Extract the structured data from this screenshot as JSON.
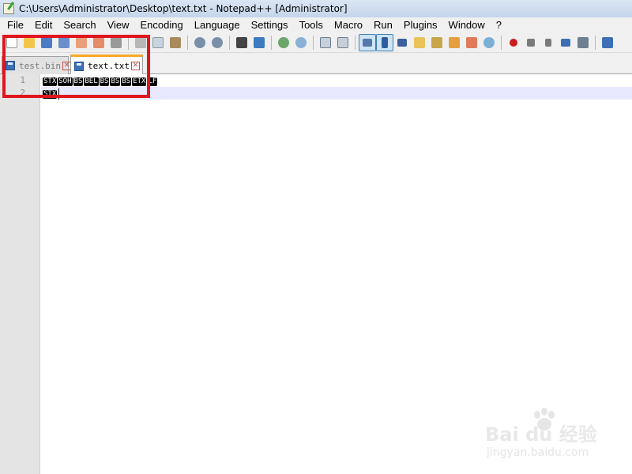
{
  "window": {
    "title": "C:\\Users\\Administrator\\Desktop\\text.txt - Notepad++ [Administrator]"
  },
  "menu": [
    "File",
    "Edit",
    "Search",
    "View",
    "Encoding",
    "Language",
    "Settings",
    "Tools",
    "Macro",
    "Run",
    "Plugins",
    "Window",
    "?"
  ],
  "toolbar": {
    "icons": [
      "new-file-icon",
      "open-file-icon",
      "save-icon",
      "save-all-icon",
      "close-icon",
      "close-all-icon",
      "print-icon",
      "cut-icon",
      "copy-icon",
      "paste-icon",
      "undo-icon",
      "redo-icon",
      "find-icon",
      "replace-icon",
      "zoom-in-icon",
      "zoom-out-icon",
      "sync-vertical-icon",
      "sync-horizontal-icon",
      "word-wrap-icon",
      "show-all-chars-icon",
      "indent-guide-icon",
      "doc-map-icon",
      "function-list-icon",
      "folder-workspace-icon",
      "monitoring-icon",
      "record-macro-icon",
      "stop-record-icon",
      "play-macro-icon",
      "run-macro-multiple-icon",
      "save-macro-icon"
    ],
    "pressed": [
      "word-wrap-icon",
      "show-all-chars-icon"
    ]
  },
  "tabs": [
    {
      "label": "test.bin",
      "active": false
    },
    {
      "label": "text.txt",
      "active": true
    }
  ],
  "editor": {
    "line_numbers": [
      "1",
      "2"
    ],
    "lines": [
      [
        "STX",
        "SOH",
        "BS",
        "BEL",
        "BS",
        "BS",
        "BS",
        "ETX",
        "LF"
      ],
      [
        "STX"
      ]
    ],
    "current_line": 2
  },
  "watermark": {
    "logo": "Bai du 经验",
    "url": "jingyan.baidu.com"
  },
  "colors": {
    "highlight_box": "#e0151d",
    "active_tab_accent": "#f9a825",
    "current_line_bg": "#e8e8ff"
  }
}
